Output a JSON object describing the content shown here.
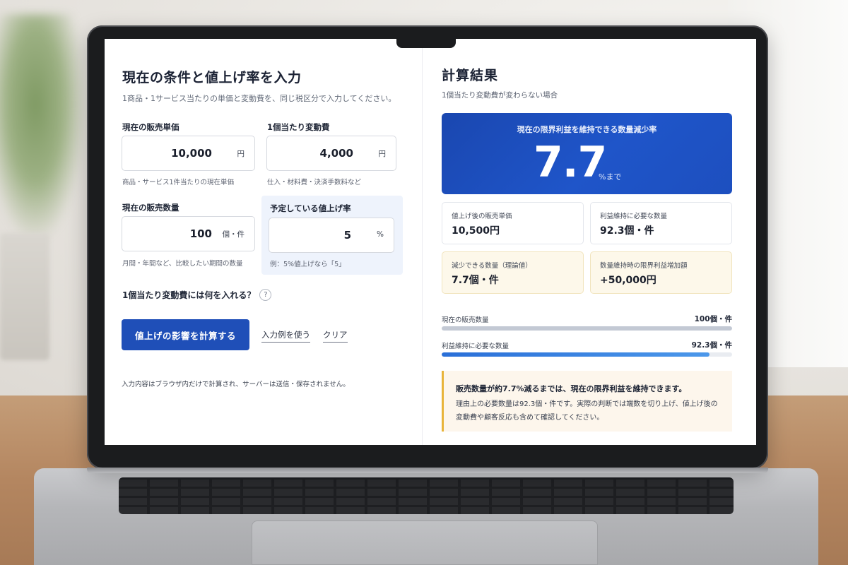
{
  "colors": {
    "primary": "#1f4fb8",
    "hero": "#1d4fbf",
    "warm_card": "#fdf8ea",
    "accent_note": "#e8b43a",
    "bar_current": "#c3c9d4",
    "bar_required": "#3d84e3"
  },
  "input_panel": {
    "title": "現在の条件と値上げ率を入力",
    "subtitle": "1商品・1サービス当たりの単価と変動費を、同じ税区分で入力してください。",
    "price": {
      "label": "現在の販売単価",
      "value": "10,000",
      "unit": "円",
      "hint": "商品・サービス1件当たりの現在単価"
    },
    "variable_cost": {
      "label": "1個当たり変動費",
      "value": "4,000",
      "unit": "円",
      "hint": "仕入・材料費・決済手数料など"
    },
    "quantity": {
      "label": "現在の販売数量",
      "value": "100",
      "unit": "個・件",
      "hint": "月間・年間など、比較したい期間の数量"
    },
    "increase_rate": {
      "label": "予定している値上げ率",
      "value": "5",
      "unit": "%",
      "hint": "例：5%値上げなら「5」"
    },
    "question": "1個当たり変動費には何を入れる？",
    "question_icon": "?",
    "calc_button": "値上げの影響を計算する",
    "example_link": "入力例を使う",
    "clear_link": "クリア",
    "footnote": "入力内容はブラウザ内だけで計算され、サーバーは送信・保存されません。"
  },
  "result_panel": {
    "title": "計算結果",
    "subtitle": "1個当たり変動費が変わらない場合",
    "hero": {
      "title": "現在の限界利益を維持できる数量減少率",
      "value": "7.7",
      "unit": "%まで"
    },
    "cards": [
      {
        "label": "値上げ後の販売単価",
        "value": "10,500円"
      },
      {
        "label": "利益維持に必要な数量",
        "value": "92.3個・件"
      },
      {
        "label": "減少できる数量（理論値）",
        "value": "7.7個・件"
      },
      {
        "label": "数量維持時の限界利益増加額",
        "value": "+50,000円"
      }
    ],
    "bars": [
      {
        "label": "現在の販売数量",
        "value": "100個・件",
        "level": 1.0
      },
      {
        "label": "利益維持に必要な数量",
        "value": "92.3個・件",
        "level": 0.923
      }
    ],
    "note": {
      "title": "販売数量が約7.7%減るまでは、現在の限界利益を維持できます。",
      "body": "理由上の必要数量は92.3個・件です。実際の判断では端数を切り上げ、値上げ後の変動費や顧客反応も含めて確認してください。"
    }
  }
}
